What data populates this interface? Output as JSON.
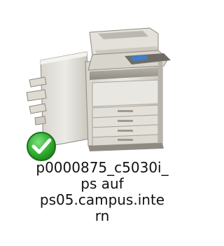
{
  "printer": {
    "name_lines": [
      "p0000875_c5030i_",
      "ps auf",
      "ps05.campus.inte",
      "rn"
    ],
    "icon": "multifunction-printer-icon",
    "status_icon": "default-printer-check-icon"
  },
  "colors": {
    "check_green": "#2fb02f",
    "check_rim": "#1f6f1f",
    "body_light": "#e9e7e2",
    "body_mid": "#cfccc4",
    "body_dark": "#9e9a91"
  }
}
